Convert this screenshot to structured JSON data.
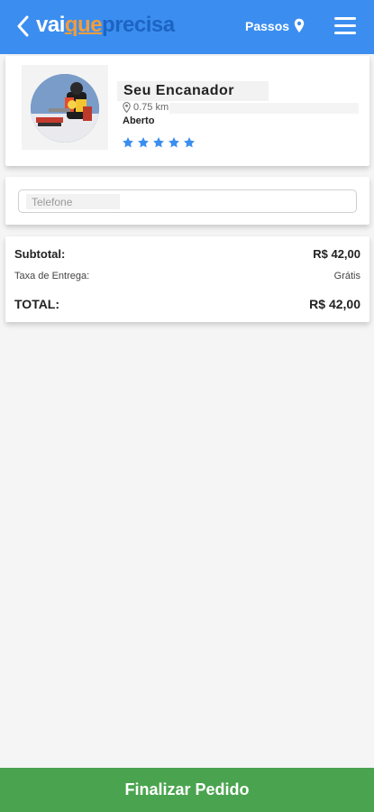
{
  "header": {
    "logo": {
      "part1": "vai",
      "part2": "que",
      "part3": "precisa"
    },
    "steps_label": "Passos",
    "icons": {
      "back": "chevron-left-icon",
      "location": "map-pin-icon",
      "menu": "hamburger-menu-icon"
    }
  },
  "store": {
    "name": "Seu Encanador",
    "distance": "0.75 km",
    "status": "Aberto",
    "rating": 5,
    "rating_max": 5,
    "icons": {
      "distance": "map-pin-icon",
      "star": "star-icon"
    }
  },
  "phone": {
    "placeholder": "Telefone",
    "value": ""
  },
  "summary": {
    "subtotal_label": "Subtotal:",
    "subtotal_value": "R$ 42,00",
    "delivery_label": "Taxa de Entrega:",
    "delivery_value": "Grátis",
    "total_label": "TOTAL:",
    "total_value": "R$ 42,00"
  },
  "finish_button": "Finalizar Pedido",
  "colors": {
    "header": "#3b8ef0",
    "logo_accent": "#f39c3a",
    "star": "#3b8ef0",
    "finish_button": "#4aa44f"
  }
}
